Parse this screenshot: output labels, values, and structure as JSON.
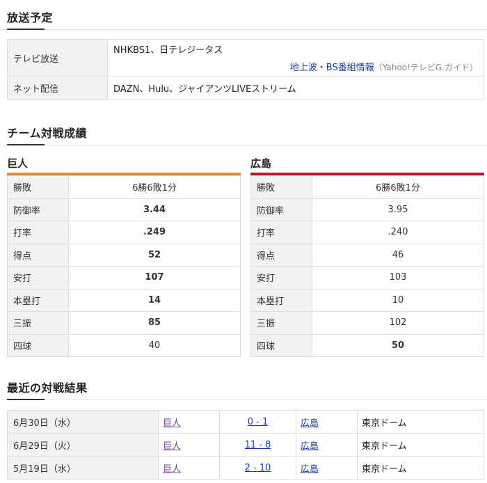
{
  "broadcast": {
    "title": "放送予定",
    "tv_label": "テレビ放送",
    "tv_value": "NHKBS1、日テレジータス",
    "tv_link": "地上波・BS番組情報",
    "tv_note": "（Yahoo!テレビG.ガイド）",
    "net_label": "ネット配信",
    "net_value": "DAZN、Hulu、ジャイアンツLIVEストリーム"
  },
  "record": {
    "title": "チーム対戦成績",
    "teams": [
      {
        "name": "巨人",
        "color": "#e8892b",
        "stats": [
          {
            "label": "勝敗",
            "value": "6勝6敗1分"
          },
          {
            "label": "防御率",
            "value": "3.44"
          },
          {
            "label": "打率",
            "value": ".249"
          },
          {
            "label": "得点",
            "value": "52"
          },
          {
            "label": "安打",
            "value": "107"
          },
          {
            "label": "本塁打",
            "value": "14"
          },
          {
            "label": "三振",
            "value": "85"
          },
          {
            "label": "四球",
            "value": "40"
          }
        ]
      },
      {
        "name": "広島",
        "color": "#b21c24",
        "stats": [
          {
            "label": "勝敗",
            "value": "6勝6敗1分"
          },
          {
            "label": "防御率",
            "value": "3.95"
          },
          {
            "label": "打率",
            "value": ".240"
          },
          {
            "label": "得点",
            "value": "46"
          },
          {
            "label": "安打",
            "value": "103"
          },
          {
            "label": "本塁打",
            "value": "10"
          },
          {
            "label": "三振",
            "value": "102"
          },
          {
            "label": "四球",
            "value": "50"
          }
        ]
      }
    ]
  },
  "results": {
    "title": "最近の対戦結果",
    "rows": [
      {
        "date": "6月30日（水）",
        "home": "巨人",
        "score": "0 - 1",
        "away": "広島",
        "venue": "東京ドーム"
      },
      {
        "date": "6月29日（火）",
        "home": "巨人",
        "score": "11 - 8",
        "away": "広島",
        "venue": "東京ドーム"
      },
      {
        "date": "5月19日（水）",
        "home": "巨人",
        "score": "2 - 10",
        "away": "広島",
        "venue": "東京ドーム"
      }
    ]
  }
}
